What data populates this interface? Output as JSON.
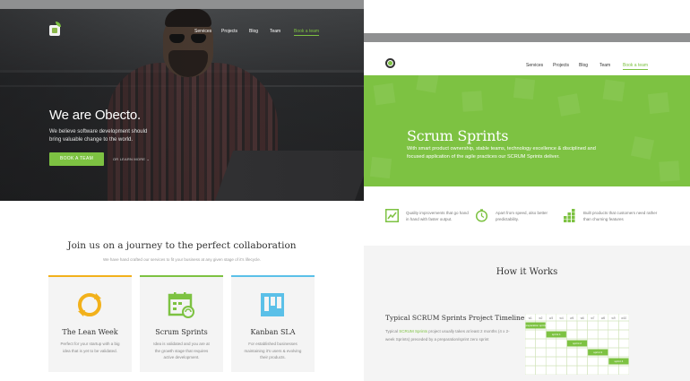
{
  "left_page": {
    "nav": {
      "items": [
        "Services",
        "Projects",
        "Blog",
        "Team"
      ],
      "cta": "Book a team"
    },
    "hero": {
      "title": "We are Obecto.",
      "subtitle": "We believe software development should bring valuable change to the world.",
      "button": "BOOK A TEAM",
      "learn_more": "OR LEARN MORE"
    },
    "section": {
      "title": "Join us on a journey to the perfect collaboration",
      "subtitle": "We have hand crafted our services to fit your business at any given stage of it's lifecycle."
    },
    "cards": [
      {
        "title": "The Lean Week",
        "text": "Perfect for your startup with a big idea that is yet to be validated.",
        "accent": "#f2b11b",
        "icon": "cycle-arrows-icon"
      },
      {
        "title": "Scrum Sprints",
        "text": "Idea is validated and you are at the growth stage that requires active development.",
        "accent": "#7dc242",
        "icon": "calendar-sync-icon"
      },
      {
        "title": "Kanban SLA",
        "text": "For established businesses maintaining it's users & evolving their products.",
        "accent": "#5bc0e8",
        "icon": "kanban-board-icon"
      }
    ]
  },
  "right_page": {
    "nav": {
      "items": [
        "Services",
        "Projects",
        "Blog",
        "Team"
      ],
      "cta": "Book a team"
    },
    "hero": {
      "title": "Scrum Sprints",
      "subtitle": "With smart product ownership, stable teams, technology excellence & disciplined and focused application of the agile practices our SCRUM Sprints deliver."
    },
    "features": [
      {
        "icon": "trend-chart-icon",
        "text": "Quality improvements that go hand in hand with faster output."
      },
      {
        "icon": "stopwatch-icon",
        "text": "Apart from speed, also better predictability."
      },
      {
        "icon": "blocks-icon",
        "text": "Built products that customers need rather than churning features"
      }
    ],
    "how_it_works": {
      "title": "How it Works",
      "timeline_title": "Typical SCRUM Sprints Project Timeline",
      "text_prefix": "Typical ",
      "text_link": "SCRUM Sprints",
      "text_suffix": " project usually takes at least 2 months (4 x 2-week Sprints) preceded by a preparation/sprint zero sprint",
      "columns": [
        "w1",
        "w2",
        "w3",
        "w4",
        "w5",
        "w6",
        "w7",
        "w8",
        "w9",
        "w10"
      ],
      "bars": [
        {
          "label": "preparation sprint",
          "start": 0,
          "span": 2,
          "row": 0
        },
        {
          "label": "sprint 1",
          "start": 2,
          "span": 2,
          "row": 1
        },
        {
          "label": "sprint 2",
          "start": 4,
          "span": 2,
          "row": 2
        },
        {
          "label": "sprint 3",
          "start": 6,
          "span": 2,
          "row": 3
        },
        {
          "label": "sprint 4",
          "start": 8,
          "span": 2,
          "row": 4
        }
      ]
    }
  },
  "colors": {
    "accent_green": "#7dc242",
    "accent_yellow": "#f2b11b",
    "accent_blue": "#5bc0e8"
  }
}
